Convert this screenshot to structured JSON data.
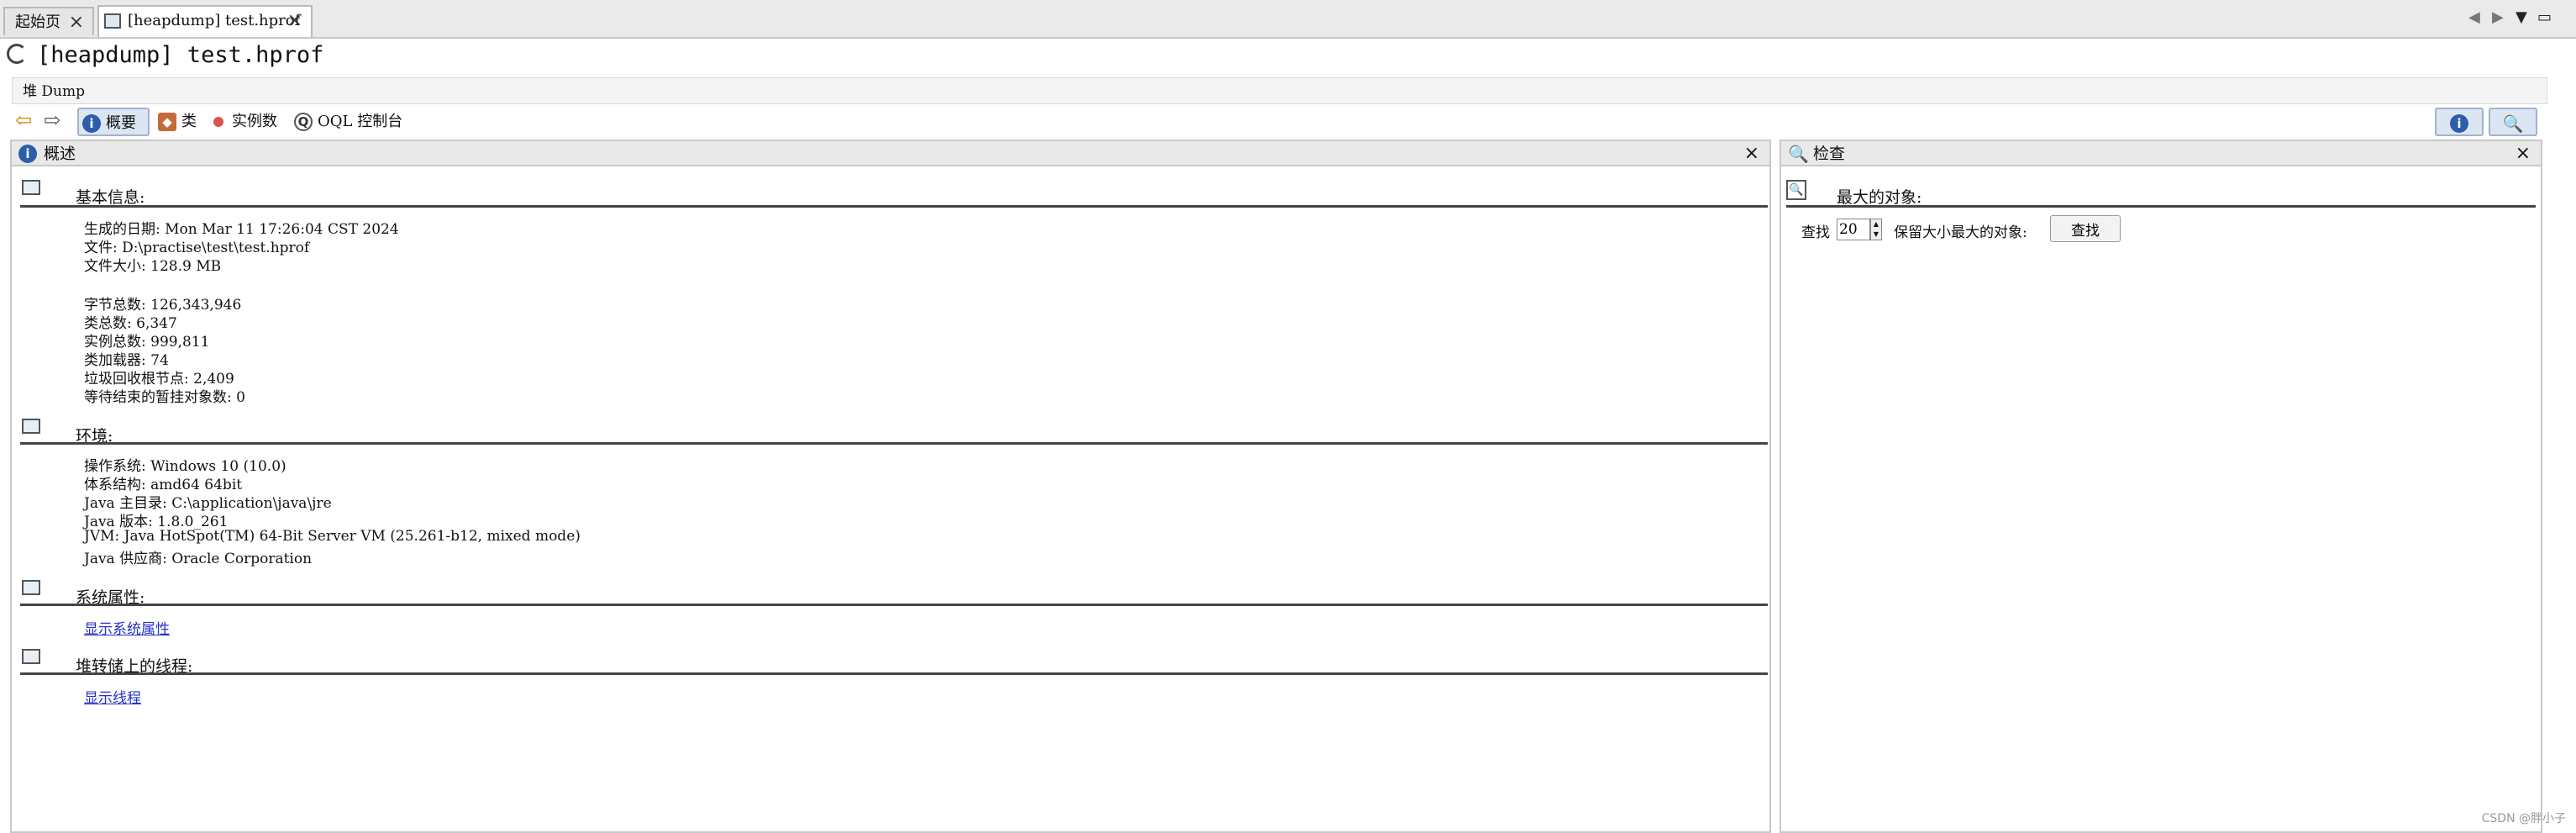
{
  "tabs": [
    {
      "label": "起始页"
    },
    {
      "label": "[heapdump] test.hprof"
    }
  ],
  "title": "[heapdump] test.hprof",
  "breadcrumb": "堆 Dump",
  "toolbar": {
    "summary": "概要",
    "classes": "类",
    "instances": "实例数",
    "oql": "OQL 控制台"
  },
  "overview": {
    "header": "概述",
    "basic": {
      "title": "基本信息:",
      "lines": [
        "生成的日期: Mon Mar 11 17:26:04 CST 2024",
        "文件: D:\\practise\\test\\test.hprof",
        "文件大小: 128.9 MB",
        "字节总数: 126,343,946",
        "类总数: 6,347",
        "实例总数: 999,811",
        "类加载器: 74",
        "垃圾回收根节点: 2,409",
        "等待结束的暂挂对象数: 0"
      ]
    },
    "env": {
      "title": "环境:",
      "lines": [
        "操作系统: Windows 10 (10.0)",
        "体系结构: amd64 64bit",
        "Java 主目录: C:\\application\\java\\jre",
        "Java 版本: 1.8.0_261",
        "JVM: Java HotSpot(TM) 64-Bit Server VM (25.261-b12, mixed mode)",
        "Java 供应商: Oracle Corporation"
      ]
    },
    "sysprops": {
      "title": "系统属性:",
      "link": "显示系统属性"
    },
    "threads": {
      "title": "堆转储上的线程:",
      "link": "显示线程"
    }
  },
  "inspect": {
    "header": "检查",
    "title": "最大的对象:",
    "find_label": "查找",
    "count": "20",
    "suffix": "保留大小最大的对象:",
    "button": "查找"
  },
  "watermark": "CSDN @胖小子"
}
